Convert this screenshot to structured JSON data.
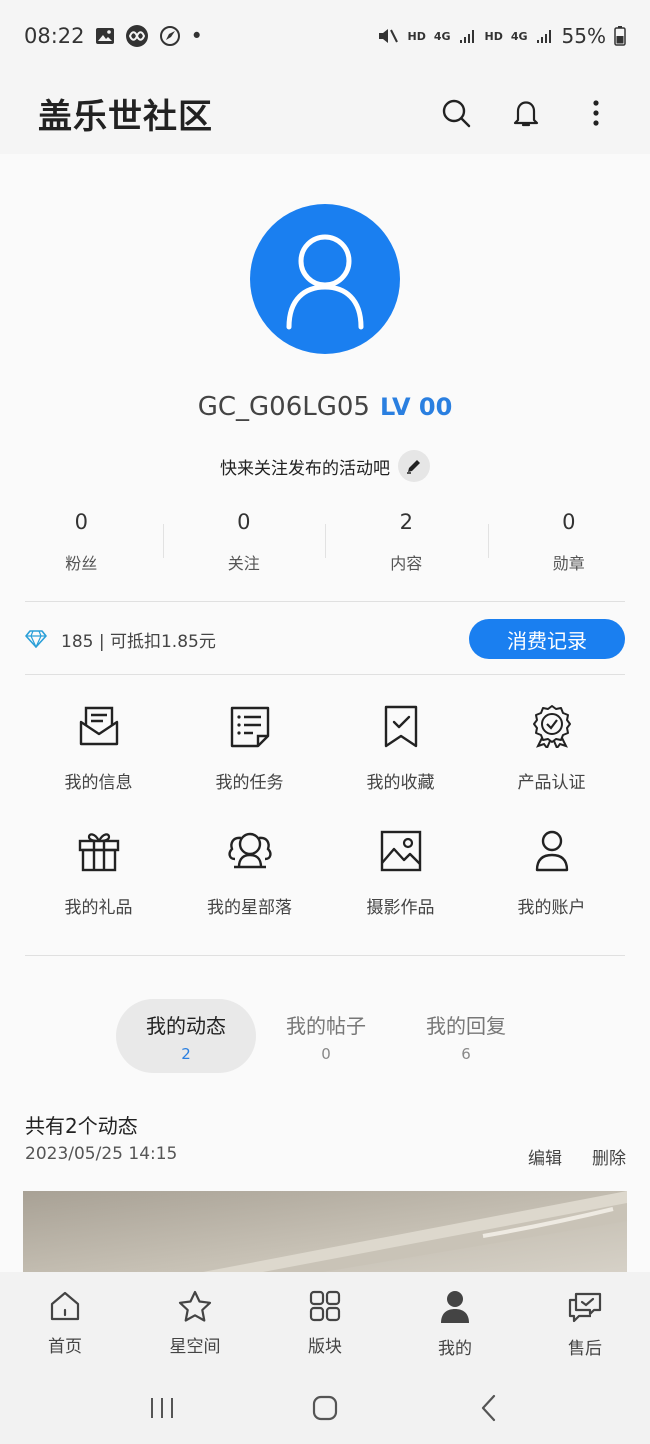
{
  "status_bar": {
    "time": "08:22",
    "battery": "55%",
    "hd1": "HD",
    "net1": "4G",
    "hd2": "HD",
    "net2": "4G"
  },
  "header": {
    "title": "盖乐世社区",
    "icons": [
      "search-icon",
      "bell-icon",
      "more-icon"
    ]
  },
  "profile": {
    "username": "GC_G06LG05",
    "level": "LV 00",
    "bio": "快来关注发布的活动吧",
    "avatar_color": "#1a7ff0"
  },
  "stats": [
    {
      "value": "0",
      "label": "粉丝"
    },
    {
      "value": "0",
      "label": "关注"
    },
    {
      "value": "2",
      "label": "内容"
    },
    {
      "value": "0",
      "label": "勋章"
    }
  ],
  "points": {
    "text": "185 | 可抵扣1.85元",
    "button": "消费记录",
    "accent": "#1a7ff0"
  },
  "menu": [
    {
      "label": "我的信息",
      "icon": "message-icon"
    },
    {
      "label": "我的任务",
      "icon": "task-icon"
    },
    {
      "label": "我的收藏",
      "icon": "bookmark-icon"
    },
    {
      "label": "产品认证",
      "icon": "badge-icon"
    },
    {
      "label": "我的礼品",
      "icon": "gift-icon"
    },
    {
      "label": "我的星部落",
      "icon": "group-icon"
    },
    {
      "label": "摄影作品",
      "icon": "image-icon"
    },
    {
      "label": "我的账户",
      "icon": "account-icon"
    }
  ],
  "tabs": [
    {
      "label": "我的动态",
      "count": "2",
      "active": true
    },
    {
      "label": "我的帖子",
      "count": "0",
      "active": false
    },
    {
      "label": "我的回复",
      "count": "6",
      "active": false
    }
  ],
  "feed": {
    "summary": "共有2个动态",
    "date": "2023/05/25 14:15",
    "edit": "编辑",
    "delete": "删除"
  },
  "bottom_nav": [
    {
      "label": "首页",
      "icon": "home-icon"
    },
    {
      "label": "星空间",
      "icon": "star-icon"
    },
    {
      "label": "版块",
      "icon": "grid-icon"
    },
    {
      "label": "我的",
      "icon": "user-icon"
    },
    {
      "label": "售后",
      "icon": "service-icon"
    }
  ]
}
